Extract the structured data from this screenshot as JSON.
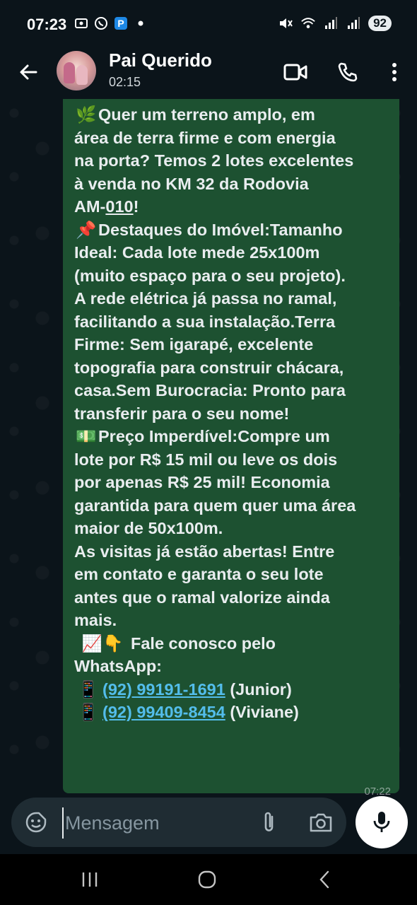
{
  "status_bar": {
    "time": "07:23",
    "battery": "92",
    "left_icons": [
      "screenshot-icon",
      "whatsapp-icon",
      "parking-app-icon",
      "dot-icon"
    ],
    "right_icons": [
      "mute-icon",
      "wifi-icon",
      "signal-icon",
      "signal-icon"
    ]
  },
  "header": {
    "contact_name": "Pai Querido",
    "contact_status": "02:15",
    "icons": [
      "back-arrow-icon",
      "video-call-icon",
      "phone-icon",
      "more-vert-icon"
    ]
  },
  "message": {
    "lines": [
      {
        "emoji": "🌿",
        "text": "Quer um terreno amplo, em"
      },
      {
        "text": "área de terra firme e com energia"
      },
      {
        "text": "na porta? Temos 2 lotes excelentes"
      },
      {
        "text": "à venda no KM 32 da Rodovia"
      },
      {
        "text_prefix": "AM-",
        "text_underlined": "010",
        "text_suffix": "!"
      },
      {
        "emoji": "📌",
        "text": "Destaques do Imóvel:Tamanho"
      },
      {
        "text": "Ideal: Cada lote mede 25x100m"
      },
      {
        "text": "(muito espaço para o seu projeto)."
      },
      {
        "text": "A rede elétrica já passa no ramal,"
      },
      {
        "text": "facilitando a sua instalação.Terra"
      },
      {
        "text": "Firme: Sem igarapé, excelente"
      },
      {
        "text": "topografia para construir chácara,"
      },
      {
        "text": "casa.Sem Burocracia: Pronto para"
      },
      {
        "text": "transferir para o seu nome!"
      },
      {
        "emoji": "💵",
        "text": "Preço Imperdível:Compre um"
      },
      {
        "text": "lote por R$ 15 mil ou leve os dois"
      },
      {
        "text": "por apenas R$ 25 mil! Economia"
      },
      {
        "text": "garantida para quem quer uma área"
      },
      {
        "text": "maior de 50x100m."
      },
      {
        "text": "As visitas já estão abertas! Entre"
      },
      {
        "text": "em contato e garanta o seu lote"
      },
      {
        "text": "antes que o ramal valorize ainda"
      },
      {
        "text": "mais."
      },
      {
        "emoji": "📈👇",
        "text": "Fale conosco pelo"
      },
      {
        "text": "WhatsApp:"
      },
      {
        "emoji": "📱",
        "link": "(92) 99191-1691",
        "text": "(Junior)"
      },
      {
        "emoji": "📱",
        "link": "(92) 99409-8454",
        "text": "(Viviane)"
      }
    ],
    "time": "07:22"
  },
  "composer": {
    "placeholder": "Mensagem",
    "value": ""
  },
  "nav": {
    "icons": [
      "recent-apps-icon",
      "home-icon",
      "back-icon"
    ]
  }
}
